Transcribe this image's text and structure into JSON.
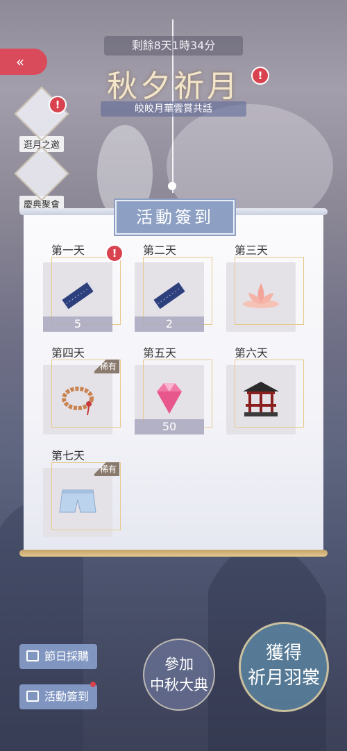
{
  "header": {
    "timer": "剩餘8天1時34分",
    "title": "秋夕祈月",
    "subtitle": "皎皎月華雲賞共話"
  },
  "side_menu": [
    {
      "label": "逛月之邀"
    },
    {
      "label": "慶典聚會"
    }
  ],
  "panel": {
    "title": "活動簽到",
    "days": [
      {
        "label": "第一天",
        "count": "5",
        "rare": "",
        "item": "scroll-icon",
        "alert": "!"
      },
      {
        "label": "第二天",
        "count": "2",
        "rare": "",
        "item": "scroll-icon"
      },
      {
        "label": "第三天",
        "count": "",
        "rare": "",
        "item": "lotus-icon"
      },
      {
        "label": "第四天",
        "count": "",
        "rare": "稀有",
        "item": "bracelet-icon"
      },
      {
        "label": "第五天",
        "count": "50",
        "rare": "",
        "item": "diamond-icon"
      },
      {
        "label": "第六天",
        "count": "",
        "rare": "",
        "item": "pavilion-icon"
      },
      {
        "label": "第七天",
        "count": "",
        "rare": "稀有",
        "item": "shorts-icon"
      }
    ]
  },
  "bottom": {
    "shop_label": "節日採購",
    "signin_label": "活動簽到",
    "join_label_1": "參加",
    "join_label_2": "中秋大典",
    "obtain_label_1": "獲得",
    "obtain_label_2": "祈月羽裳"
  },
  "colors": {
    "accent_red": "#d94a5b",
    "panel_title_bg": "#8da0c4",
    "gold_frame": "#e7c98c"
  }
}
